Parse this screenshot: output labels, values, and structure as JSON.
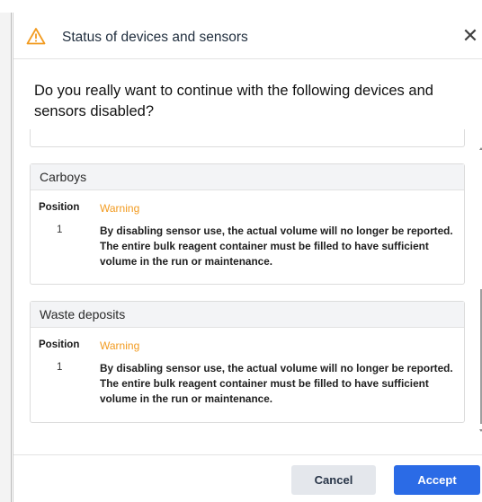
{
  "dialog": {
    "title": "Status of devices and sensors",
    "close_glyph": "✕",
    "question": "Do you really want to continue with the following devices and sensors disabled?",
    "header_icon": "warning-triangle-icon",
    "accent_warning_color": "#f29b20"
  },
  "sections": [
    {
      "title": "Carboys",
      "col_position": "Position",
      "col_warning": "Warning",
      "rows": [
        {
          "position": "1",
          "warning": "By disabling sensor use, the actual volume will no longer be reported. The entire bulk reagent container must be filled to have sufficient volume in the run or maintenance."
        }
      ]
    },
    {
      "title": "Waste deposits",
      "col_position": "Position",
      "col_warning": "Warning",
      "rows": [
        {
          "position": "1",
          "warning": "By disabling sensor use, the actual volume will no longer be reported. The entire bulk reagent container must be filled to have sufficient volume in the run or maintenance."
        }
      ]
    }
  ],
  "footer": {
    "cancel_label": "Cancel",
    "accept_label": "Accept",
    "accept_color": "#2b6be6"
  }
}
